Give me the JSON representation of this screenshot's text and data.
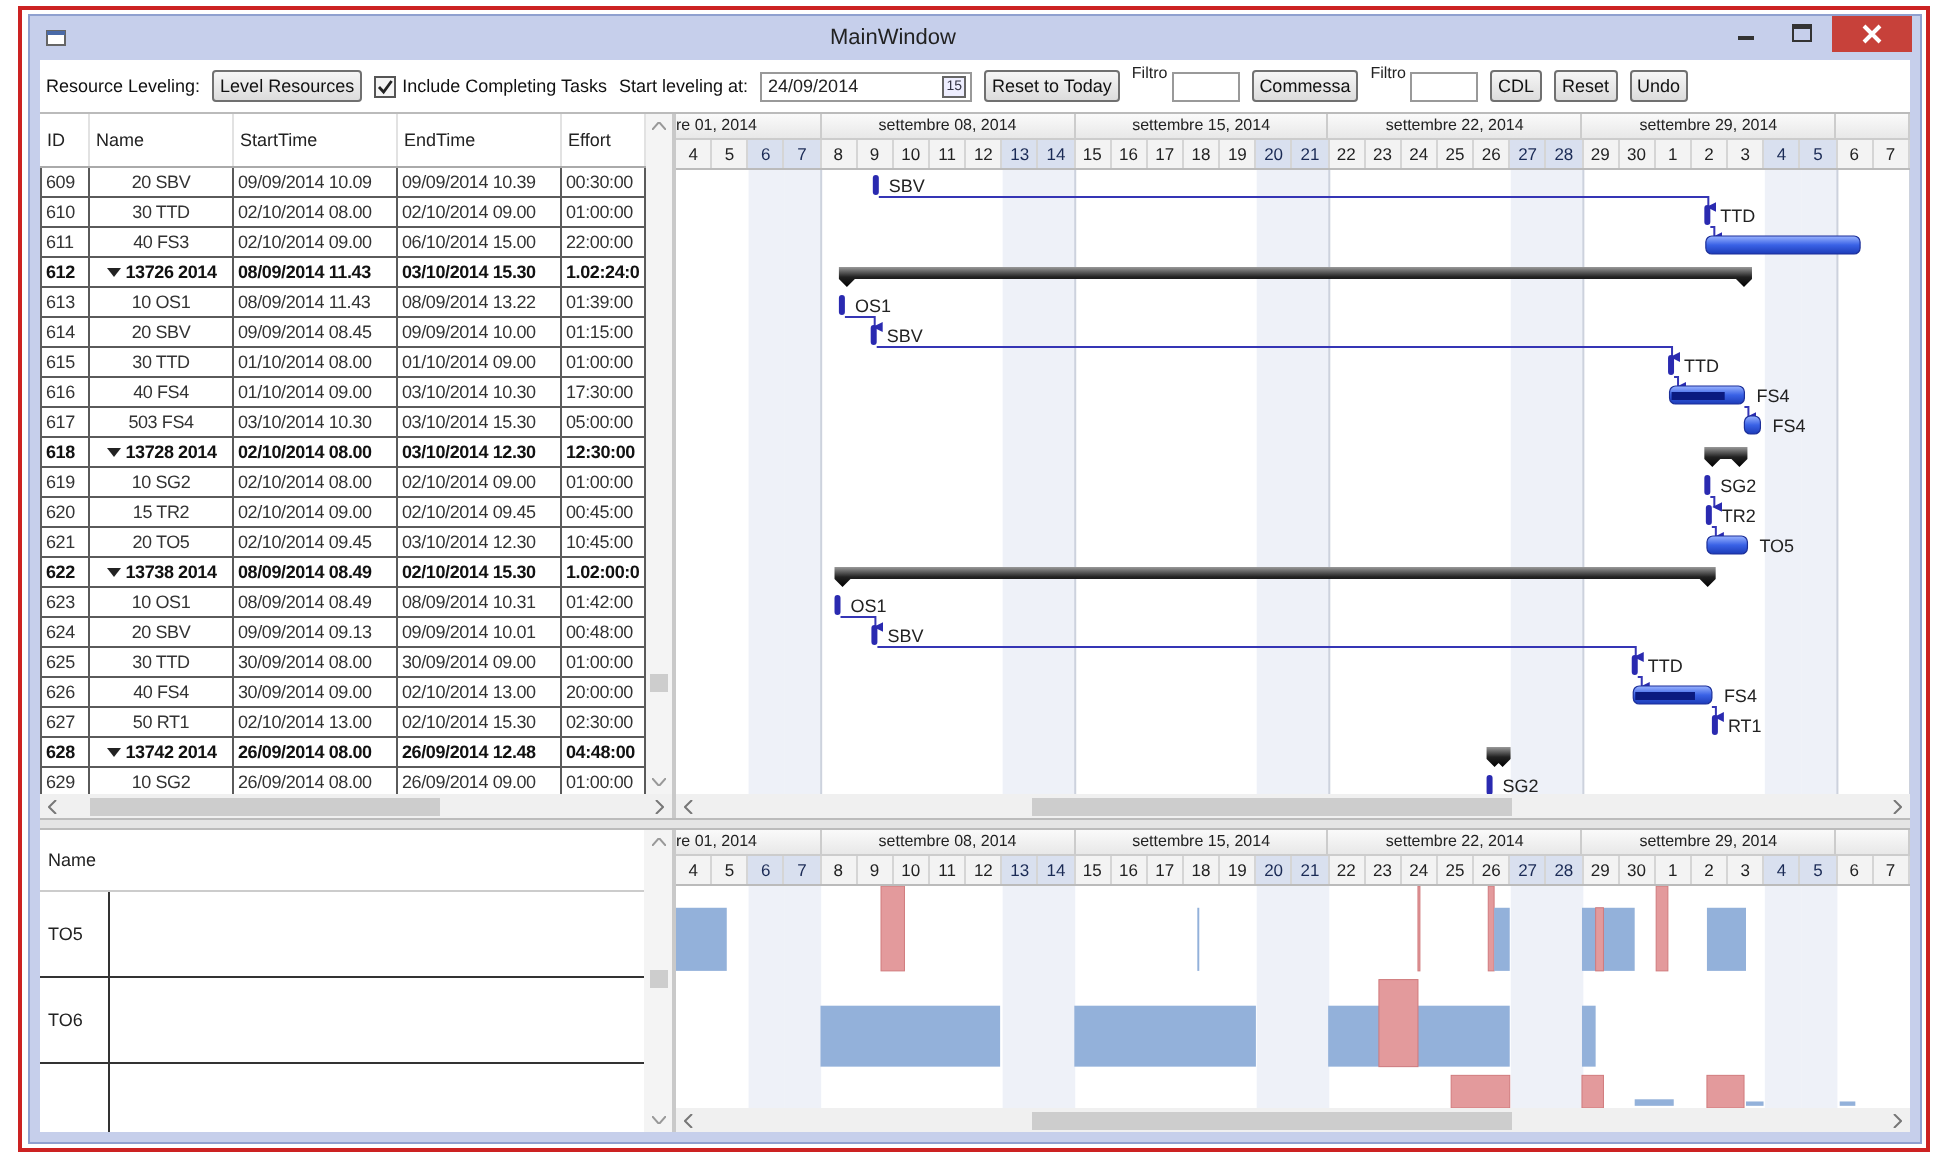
{
  "window": {
    "title": "MainWindow"
  },
  "toolbar": [
    {
      "kind": "label",
      "text": "Resource Leveling:"
    },
    {
      "kind": "button",
      "text": "Level Resources"
    },
    {
      "kind": "checkbox",
      "text": "Include Completing Tasks",
      "checked": true
    },
    {
      "kind": "label",
      "text": "Start leveling at:"
    },
    {
      "kind": "date",
      "value": "24/09/2014",
      "icon_text": "15"
    },
    {
      "kind": "button",
      "text": "Reset to Today"
    },
    {
      "kind": "field",
      "label": "Filtro"
    },
    {
      "kind": "button",
      "text": "Commessa"
    },
    {
      "kind": "field",
      "label": "Filtro"
    },
    {
      "kind": "button",
      "text": "CDL"
    },
    {
      "kind": "button",
      "text": "Reset"
    },
    {
      "kind": "button",
      "text": "Undo"
    }
  ],
  "task_grid": {
    "columns": [
      "ID",
      "Name",
      "StartTime",
      "EndTime",
      "Effort"
    ],
    "rows": [
      {
        "kind": "task",
        "id": "609",
        "name": "20 SBV",
        "start": "09/09/2014 10.09",
        "end": "09/09/2014 10.39",
        "effort": "00:30:00",
        "bar_label": "SBV"
      },
      {
        "kind": "task",
        "id": "610",
        "name": "30 TTD",
        "start": "02/10/2014 08.00",
        "end": "02/10/2014 09.00",
        "effort": "01:00:00",
        "bar_label": "TTD"
      },
      {
        "kind": "task",
        "id": "611",
        "name": "40 FS3",
        "start": "02/10/2014 09.00",
        "end": "06/10/2014 15.00",
        "effort": "22:00:00"
      },
      {
        "kind": "summary",
        "id": "612",
        "name": "13726 2014",
        "start": "08/09/2014 11.43",
        "end": "03/10/2014 15.30",
        "effort": "1.02:24:0",
        "expanded": true
      },
      {
        "kind": "task",
        "id": "613",
        "name": "10 OS1",
        "start": "08/09/2014 11.43",
        "end": "08/09/2014 13.22",
        "effort": "01:39:00",
        "bar_label": "OS1"
      },
      {
        "kind": "task",
        "id": "614",
        "name": "20 SBV",
        "start": "09/09/2014 08.45",
        "end": "09/09/2014 10.00",
        "effort": "01:15:00",
        "bar_label": "SBV"
      },
      {
        "kind": "task",
        "id": "615",
        "name": "30 TTD",
        "start": "01/10/2014 08.00",
        "end": "01/10/2014 09.00",
        "effort": "01:00:00",
        "bar_label": "TTD"
      },
      {
        "kind": "task",
        "id": "616",
        "name": "40 FS4",
        "start": "01/10/2014 09.00",
        "end": "03/10/2014 10.30",
        "effort": "17:30:00",
        "bar_label": "FS4",
        "level": 0.75
      },
      {
        "kind": "task",
        "id": "617",
        "name": "503 FS4",
        "start": "03/10/2014 10.30",
        "end": "03/10/2014 15.30",
        "effort": "05:00:00",
        "bar_label": "FS4"
      },
      {
        "kind": "summary",
        "id": "618",
        "name": "13728 2014",
        "start": "02/10/2014 08.00",
        "end": "03/10/2014 12.30",
        "effort": "12:30:00",
        "expanded": true
      },
      {
        "kind": "task",
        "id": "619",
        "name": "10 SG2",
        "start": "02/10/2014 08.00",
        "end": "02/10/2014 09.00",
        "effort": "01:00:00",
        "bar_label": "SG2"
      },
      {
        "kind": "task",
        "id": "620",
        "name": "15 TR2",
        "start": "02/10/2014 09.00",
        "end": "02/10/2014 09.45",
        "effort": "00:45:00",
        "bar_label": "TR2"
      },
      {
        "kind": "task",
        "id": "621",
        "name": "20 TO5",
        "start": "02/10/2014 09.45",
        "end": "03/10/2014 12.30",
        "effort": "10:45:00",
        "bar_label": "TO5"
      },
      {
        "kind": "summary",
        "id": "622",
        "name": "13738 2014",
        "start": "08/09/2014 08.49",
        "end": "02/10/2014 15.30",
        "effort": "1.02:00:0",
        "expanded": true
      },
      {
        "kind": "task",
        "id": "623",
        "name": "10 OS1",
        "start": "08/09/2014 08.49",
        "end": "08/09/2014 10.31",
        "effort": "01:42:00",
        "bar_label": "OS1"
      },
      {
        "kind": "task",
        "id": "624",
        "name": "20 SBV",
        "start": "09/09/2014 09.13",
        "end": "09/09/2014 10.01",
        "effort": "00:48:00",
        "bar_label": "SBV"
      },
      {
        "kind": "task",
        "id": "625",
        "name": "30 TTD",
        "start": "30/09/2014 08.00",
        "end": "30/09/2014 09.00",
        "effort": "01:00:00",
        "bar_label": "TTD"
      },
      {
        "kind": "task",
        "id": "626",
        "name": "40 FS4",
        "start": "30/09/2014 09.00",
        "end": "02/10/2014 13.00",
        "effort": "20:00:00",
        "bar_label": "FS4",
        "level": 0.8
      },
      {
        "kind": "task",
        "id": "627",
        "name": "50 RT1",
        "start": "02/10/2014 13.00",
        "end": "02/10/2014 15.30",
        "effort": "02:30:00",
        "bar_label": "RT1"
      },
      {
        "kind": "summary",
        "id": "628",
        "name": "13742 2014",
        "start": "26/09/2014 08.00",
        "end": "26/09/2014 12.48",
        "effort": "04:48:00",
        "expanded": true
      },
      {
        "kind": "task",
        "id": "629",
        "name": "10 SG2",
        "start": "26/09/2014 08.00",
        "end": "26/09/2014 09.00",
        "effort": "01:00:00",
        "bar_label": "SG2"
      }
    ]
  },
  "gantt": {
    "weeks": [
      {
        "label": "re 01, 2014",
        "days": [
          {
            "label": "4",
            "weekend": false
          },
          {
            "label": "5",
            "weekend": false
          },
          {
            "label": "6",
            "weekend": true
          },
          {
            "label": "7",
            "weekend": true
          }
        ]
      },
      {
        "label": "settembre 08, 2014",
        "days": [
          {
            "label": "8",
            "weekend": false
          },
          {
            "label": "9",
            "weekend": false
          },
          {
            "label": "10",
            "weekend": false
          },
          {
            "label": "11",
            "weekend": false
          },
          {
            "label": "12",
            "weekend": false
          },
          {
            "label": "13",
            "weekend": true
          },
          {
            "label": "14",
            "weekend": true
          }
        ]
      },
      {
        "label": "settembre 15, 2014",
        "days": [
          {
            "label": "15",
            "weekend": false
          },
          {
            "label": "16",
            "weekend": false
          },
          {
            "label": "17",
            "weekend": false
          },
          {
            "label": "18",
            "weekend": false
          },
          {
            "label": "19",
            "weekend": false
          },
          {
            "label": "20",
            "weekend": true
          },
          {
            "label": "21",
            "weekend": true
          }
        ]
      },
      {
        "label": "settembre 22, 2014",
        "days": [
          {
            "label": "22",
            "weekend": false
          },
          {
            "label": "23",
            "weekend": false
          },
          {
            "label": "24",
            "weekend": false
          },
          {
            "label": "25",
            "weekend": false
          },
          {
            "label": "26",
            "weekend": false
          },
          {
            "label": "27",
            "weekend": true
          },
          {
            "label": "28",
            "weekend": true
          }
        ]
      },
      {
        "label": "settembre 29, 2014",
        "days": [
          {
            "label": "29",
            "weekend": false
          },
          {
            "label": "30",
            "weekend": false
          },
          {
            "label": "1",
            "weekend": false
          },
          {
            "label": "2",
            "weekend": false
          },
          {
            "label": "3",
            "weekend": false
          },
          {
            "label": "4",
            "weekend": true
          },
          {
            "label": "5",
            "weekend": true
          }
        ]
      },
      {
        "days": [
          {
            "label": "6",
            "weekend": false
          },
          {
            "label": "7",
            "weekend": false
          }
        ]
      }
    ]
  },
  "resource_grid": {
    "column": "Name",
    "rows": [
      {
        "name": "TO5"
      },
      {
        "name": "TO6"
      }
    ]
  },
  "resource_chart": {
    "weeks": [
      {
        "label": "re 01, 2014",
        "days": [
          {
            "label": "4",
            "weekend": false
          },
          {
            "label": "5",
            "weekend": false
          },
          {
            "label": "6",
            "weekend": true
          },
          {
            "label": "7",
            "weekend": true
          }
        ]
      },
      {
        "label": "settembre 08, 2014",
        "days": [
          {
            "label": "8",
            "weekend": false
          },
          {
            "label": "9",
            "weekend": false
          },
          {
            "label": "10",
            "weekend": false
          },
          {
            "label": "11",
            "weekend": false
          },
          {
            "label": "12",
            "weekend": false
          },
          {
            "label": "13",
            "weekend": true
          },
          {
            "label": "14",
            "weekend": true
          }
        ]
      },
      {
        "label": "settembre 15, 2014",
        "days": [
          {
            "label": "15",
            "weekend": false
          },
          {
            "label": "16",
            "weekend": false
          },
          {
            "label": "17",
            "weekend": false
          },
          {
            "label": "18",
            "weekend": false
          },
          {
            "label": "19",
            "weekend": false
          },
          {
            "label": "20",
            "weekend": true
          },
          {
            "label": "21",
            "weekend": true
          }
        ]
      },
      {
        "label": "settembre 22, 2014",
        "days": [
          {
            "label": "22",
            "weekend": false
          },
          {
            "label": "23",
            "weekend": false
          },
          {
            "label": "24",
            "weekend": false
          },
          {
            "label": "25",
            "weekend": false
          },
          {
            "label": "26",
            "weekend": false
          },
          {
            "label": "27",
            "weekend": true
          },
          {
            "label": "28",
            "weekend": true
          }
        ]
      },
      {
        "label": "settembre 29, 2014",
        "days": [
          {
            "label": "29",
            "weekend": false
          },
          {
            "label": "30",
            "weekend": false
          },
          {
            "label": "1",
            "weekend": false
          },
          {
            "label": "2",
            "weekend": false
          },
          {
            "label": "3",
            "weekend": false
          },
          {
            "label": "4",
            "weekend": true
          },
          {
            "label": "5",
            "weekend": true
          }
        ]
      },
      {
        "days": [
          {
            "label": "6",
            "weekend": false
          },
          {
            "label": "7",
            "weekend": false
          }
        ]
      }
    ]
  }
}
